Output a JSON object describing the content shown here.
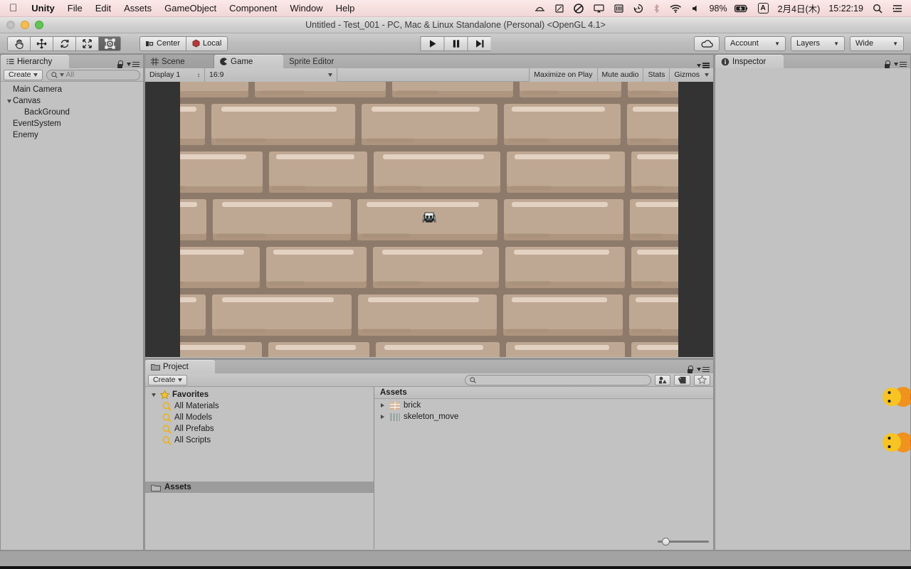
{
  "macbar": {
    "apple_icon": "apple-logo-icon",
    "menus": [
      {
        "label": "Unity",
        "bold": true
      },
      {
        "label": "File",
        "bold": false
      },
      {
        "label": "Edit",
        "bold": false
      },
      {
        "label": "Assets",
        "bold": false
      },
      {
        "label": "GameObject",
        "bold": false
      },
      {
        "label": "Component",
        "bold": false
      },
      {
        "label": "Window",
        "bold": false
      },
      {
        "label": "Help",
        "bold": false
      }
    ],
    "status_icons": [
      "scanner-icon",
      "display-rotate-icon",
      "creative-cloud-icon",
      "airplay-icon",
      "battery-meter-icon",
      "time-machine-icon",
      "bluetooth-icon",
      "wifi-icon",
      "volume-icon"
    ],
    "battery_percent": "98%",
    "battery_icon": "battery-charging-icon",
    "input_source": "A",
    "date": "2月4日(木)",
    "time": "15:22:19",
    "spotlight_icon": "search-icon",
    "notification_icon": "notification-center-icon"
  },
  "window": {
    "title": "Untitled - Test_001 - PC, Mac & Linux Standalone (Personal) <OpenGL 4.1>",
    "close_button": "close-window-button",
    "minimize_button": "minimize-window-button",
    "zoom_button": "zoom-window-button"
  },
  "toolbar": {
    "transform_tools": [
      {
        "name": "hand-tool",
        "icon": "hand-icon",
        "active": false
      },
      {
        "name": "move-tool",
        "icon": "move-arrows-icon",
        "active": false
      },
      {
        "name": "rotate-tool",
        "icon": "rotate-icon",
        "active": false
      },
      {
        "name": "scale-tool",
        "icon": "scale-icon",
        "active": false
      },
      {
        "name": "rect-tool",
        "icon": "rect-transform-icon",
        "active": true
      }
    ],
    "pivot_label": "Center",
    "pivot_icon": "pivot-center-icon",
    "space_label": "Local",
    "space_icon": "handle-local-icon",
    "play_label": "Play",
    "play_icon": "play-icon",
    "pause_label": "Pause",
    "pause_icon": "pause-icon",
    "step_label": "Step",
    "step_icon": "step-icon",
    "cloud_label": "Collab",
    "cloud_icon": "cloud-icon",
    "account_label": "Account",
    "layers_label": "Layers",
    "layout_label": "Wide"
  },
  "hierarchy": {
    "tab_label": "Hierarchy",
    "tab_icon": "hierarchy-icon",
    "create_label": "Create",
    "search_placeholder": "All",
    "search_value": "",
    "lock_icon": "lock-icon",
    "menu_icon": "panel-menu-icon",
    "items": [
      {
        "label": "Main Camera",
        "depth": 1,
        "expandable": false,
        "expanded": false
      },
      {
        "label": "Canvas",
        "depth": 0,
        "expandable": true,
        "expanded": true
      },
      {
        "label": "BackGround",
        "depth": 2,
        "expandable": false,
        "expanded": false
      },
      {
        "label": "EventSystem",
        "depth": 1,
        "expandable": false,
        "expanded": false
      },
      {
        "label": "Enemy",
        "depth": 1,
        "expandable": false,
        "expanded": false
      }
    ]
  },
  "center_panel": {
    "tabs": [
      {
        "label": "Scene",
        "icon": "scene-icon",
        "selected": false
      },
      {
        "label": "Game",
        "icon": "game-pacman-icon",
        "selected": true
      },
      {
        "label": "Sprite Editor",
        "icon": "",
        "selected": false
      }
    ],
    "display_label": "Display 1",
    "aspect_label": "16:9",
    "maximize_label": "Maximize on Play",
    "mute_label": "Mute audio",
    "stats_label": "Stats",
    "gizmos_label": "Gizmos",
    "sprite_name": "skeleton_move",
    "background_name": "brick-wall-background"
  },
  "project": {
    "tab_label": "Project",
    "tab_icon": "folder-icon",
    "create_label": "Create",
    "search_placeholder": "",
    "search_value": "",
    "lock_icon": "lock-icon",
    "menu_icon": "panel-menu-icon",
    "filter_type_icon": "filter-by-type-icon",
    "filter_label_icon": "filter-by-label-icon",
    "favorite_icon": "star-icon",
    "favorites_label": "Favorites",
    "favorites": [
      {
        "label": "All Materials",
        "icon": "saved-search-icon"
      },
      {
        "label": "All Models",
        "icon": "saved-search-icon"
      },
      {
        "label": "All Prefabs",
        "icon": "saved-search-icon"
      },
      {
        "label": "All Scripts",
        "icon": "saved-search-icon"
      }
    ],
    "assets_tree_label": "Assets",
    "assets_column_header": "Assets",
    "assets": [
      {
        "label": "brick",
        "icon": "brick-texture-icon",
        "expandable": true
      },
      {
        "label": "skeleton_move",
        "icon": "sprite-sheet-icon",
        "expandable": true
      }
    ],
    "zoom_slider_name": "icon-size-slider"
  },
  "inspector": {
    "tab_label": "Inspector",
    "tab_icon": "info-icon",
    "lock_icon": "lock-icon",
    "menu_icon": "panel-menu-icon"
  },
  "desktop": {
    "duck_sprites": [
      "duck-sprite-upper",
      "duck-sprite-lower"
    ]
  },
  "colors": {
    "menubar": "#f6dede",
    "toolbar": "#bdbdbd",
    "panel": "#c2c2c2",
    "panel_border": "#8e8e8e",
    "letterbox": "#333333",
    "brick_face": "#bfa893",
    "brick_mortar": "#8d7a6a",
    "brick_highlight": "#e9d8ca",
    "selection": "#9c9c9c",
    "duck_yellow": "#f5c518",
    "duck_orange": "#f0921e"
  }
}
